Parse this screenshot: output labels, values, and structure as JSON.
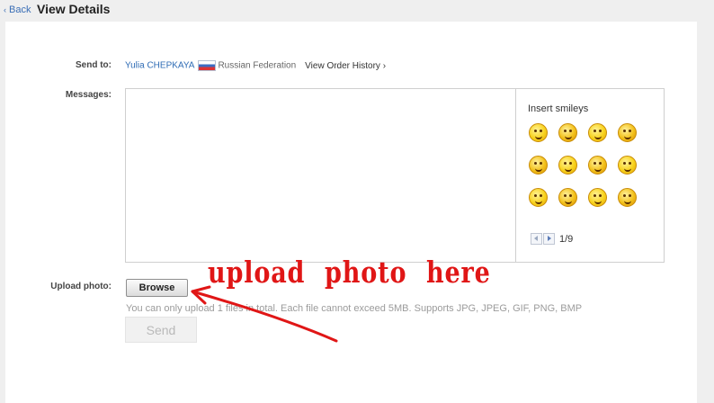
{
  "header": {
    "back_label": "Back",
    "title": "View Details"
  },
  "form": {
    "send_to_label": "Send to:",
    "recipient_name": "Yulia CHEPKAYA",
    "recipient_country": "Russian Federation",
    "view_order_history": "View Order History",
    "messages_label": "Messages:",
    "upload_photo_label": "Upload photo:",
    "browse_label": "Browse",
    "upload_hint": "You can only upload 1 files in total. Each file cannot exceed 5MB. Supports JPG, JPEG, GIF, PNG, BMP",
    "send_label": "Send"
  },
  "smileys": {
    "title": "Insert smileys",
    "page": "1/9",
    "icons": [
      "smile-icon",
      "wink-icon",
      "tongue-icon",
      "laugh-icon",
      "happy-icon",
      "shout-icon",
      "grin-icon",
      "tease-icon",
      "cry-icon",
      "dizzy-icon",
      "shy-icon",
      "chuckle-icon"
    ]
  },
  "annotation": {
    "text": "upload photo here",
    "color": "#e01616"
  },
  "colors": {
    "link": "#2f6cb5",
    "text": "#333333",
    "hint": "#9b9b9b",
    "border": "#cfcfcf"
  }
}
